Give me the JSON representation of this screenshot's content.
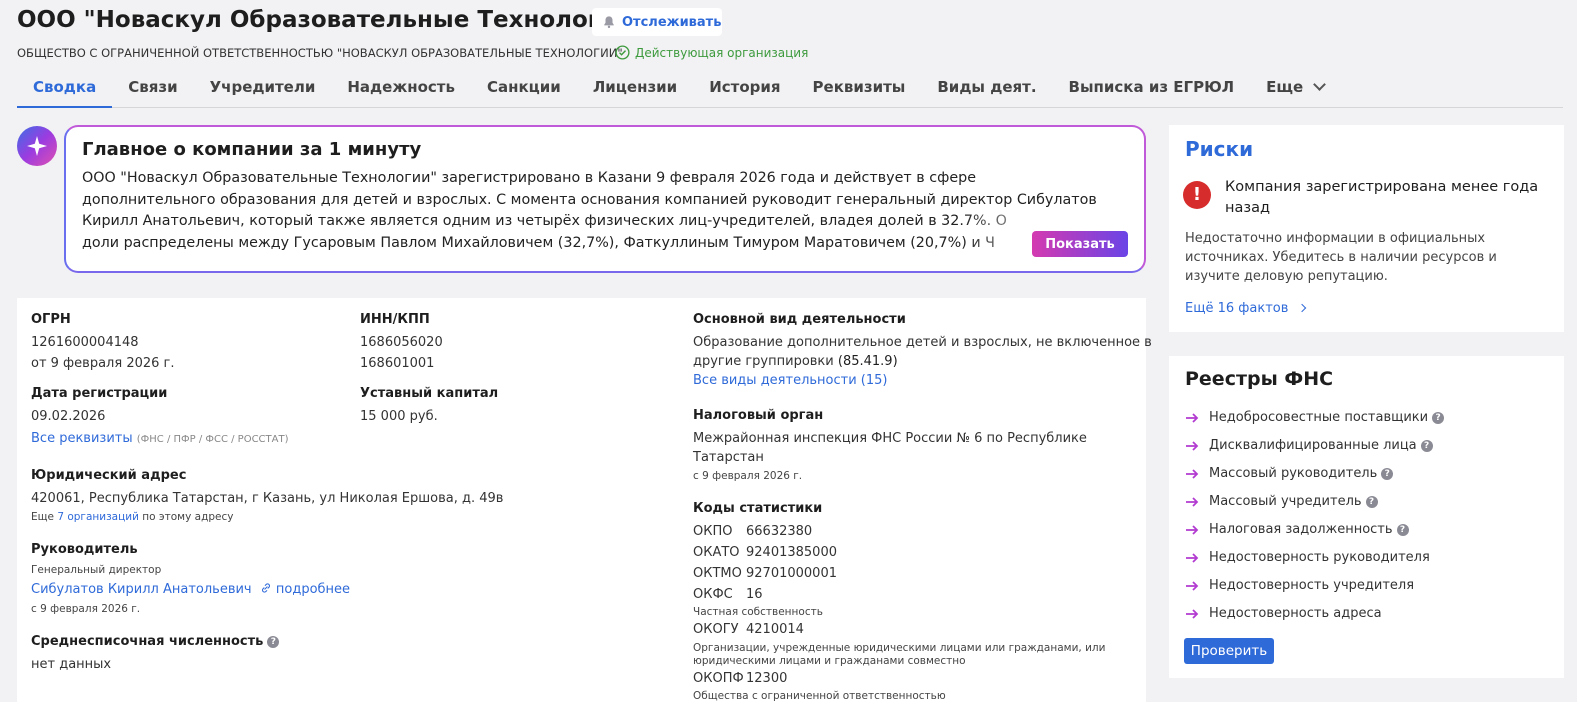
{
  "header": {
    "title": "ООО \"Новаскул Образовательные Технологии\"",
    "track_label": "Отслеживать",
    "full_name": "ОБЩЕСТВО С ОГРАНИЧЕННОЙ ОТВЕТСТВЕННОСТЬЮ \"НОВАСКУЛ ОБРАЗОВАТЕЛЬНЫЕ ТЕХНОЛОГИИ\"",
    "status": "Действующая организация"
  },
  "tabs": [
    {
      "label": "Сводка",
      "active": true
    },
    {
      "label": "Связи"
    },
    {
      "label": "Учредители"
    },
    {
      "label": "Надежность"
    },
    {
      "label": "Санкции"
    },
    {
      "label": "Лицензии"
    },
    {
      "label": "История"
    },
    {
      "label": "Реквизиты"
    },
    {
      "label": "Виды деят."
    },
    {
      "label": "Выписка из ЕГРЮЛ"
    },
    {
      "label": "Еще"
    }
  ],
  "summary": {
    "title": "Главное о компании за 1 минуту",
    "line1": "ООО \"Новаскул Образовательные Технологии\" зарегистрировано в Казани 9 февраля 2026 года и действует в сфере",
    "line2": "дополнительного образования для детей и взрослых. С момента основания компанией руководит генеральный директор Сибулатов",
    "line3": "Кирилл Анатольевич, который также является одним из четырёх физических лиц-учредителей, владея долей в 32.7%. О",
    "line4": "доли распределены между Гусаровым Павлом Михайловичем (32,7%), Фаткуллиным Тимуром Маратовичем (20,7%) и Ч",
    "show_label": "Показать"
  },
  "info": {
    "ogrn_label": "ОГРН",
    "ogrn_value": "1261600004148",
    "ogrn_date": "от 9 февраля 2026 г.",
    "inn_label": "ИНН/КПП",
    "inn_value": "1686056020",
    "kpp_value": "168601001",
    "reg_label": "Дата регистрации",
    "reg_value": "09.02.2026",
    "capital_label": "Уставный капитал",
    "capital_value": "15 000 руб.",
    "all_req_link": "Все реквизиты",
    "all_req_note": "(ФНС / ПФР / ФСС / РОССТАТ)",
    "address_label": "Юридический адрес",
    "address_value": "420061, Республика Татарстан, г Казань, ул Николая Ершова, д. 49в",
    "address_more_pre": "Еще",
    "address_more_link": "7 организаций",
    "address_more_post": "по этому адресу",
    "head_label": "Руководитель",
    "head_role": "Генеральный директор",
    "head_name": "Сибулатов Кирилл Анатольевич",
    "head_more": "подробнее",
    "head_date": "с 9 февраля 2026 г.",
    "staff_label": "Среднесписочная численность",
    "staff_value": "нет данных",
    "activity_label": "Основной вид деятельности",
    "activity_line1": "Образование дополнительное детей и взрослых, не включенное в",
    "activity_line2": "другие группировки",
    "activity_code": "(85.41.9)",
    "activity_all": "Все виды деятельности (15)",
    "tax_label": "Налоговый орган",
    "tax_line1": "Межрайонная инспекция ФНС России № 6 по Республике",
    "tax_line2": "Татарстан",
    "tax_date": "с 9 февраля 2026 г.",
    "codes_label": "Коды статистики",
    "codes": [
      {
        "name": "ОКПО",
        "value": "66632380"
      },
      {
        "name": "ОКАТО",
        "value": "92401385000"
      },
      {
        "name": "ОКТМО",
        "value": "92701000001"
      },
      {
        "name": "ОКФС",
        "value": "16"
      },
      {
        "name": "ОКОГУ",
        "value": "4210014"
      },
      {
        "name": "ОКОПФ",
        "value": "12300"
      }
    ],
    "okfs_desc": "Частная собственность",
    "okogu_desc1": "Организации, учрежденные юридическими лицами или гражданами, или",
    "okogu_desc2": "юридическими лицами и гражданами совместно",
    "okopf_desc": "Общества с ограниченной ответственностью"
  },
  "risks": {
    "title": "Риски",
    "headline": "Компания зарегистрирована менее года назад",
    "description": "Недостаточно информации в официальных источниках. Убедитесь в наличии ресурсов и изучите деловую репутацию.",
    "more": "Ещё 16 фактов"
  },
  "fns": {
    "title": "Реестры ФНС",
    "items": [
      {
        "label": "Недобросовестные поставщики",
        "help": true
      },
      {
        "label": "Дисквалифицированные лица",
        "help": true
      },
      {
        "label": "Массовый руководитель",
        "help": true
      },
      {
        "label": "Массовый учредитель",
        "help": true
      },
      {
        "label": "Налоговая задолженность",
        "help": true
      },
      {
        "label": "Недостоверность руководителя",
        "help": false
      },
      {
        "label": "Недостоверность учредителя",
        "help": false
      },
      {
        "label": "Недостоверность адреса",
        "help": false
      }
    ],
    "check_label": "Проверить"
  },
  "colors": {
    "accent": "#2f6ad9",
    "danger": "#d72c2c",
    "ok": "#3d9a3d",
    "arrow": "#b23bd1"
  }
}
